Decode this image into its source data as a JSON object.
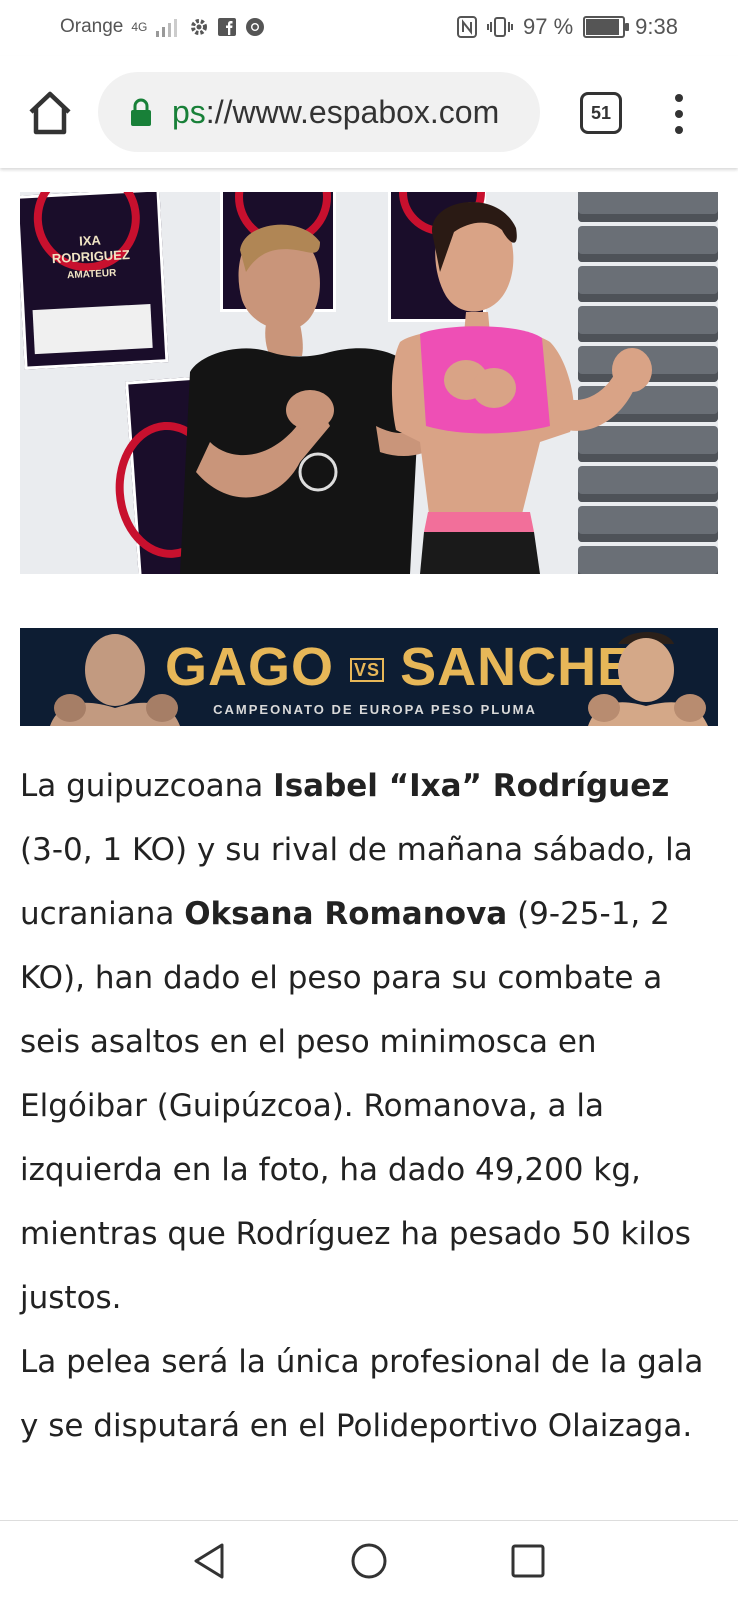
{
  "status_bar": {
    "carrier": "Orange",
    "network": "4G",
    "battery_percent": "97 %",
    "battery_level": 0.97,
    "time": "9:38"
  },
  "browser": {
    "url_scheme_fragment": "ps",
    "url_rest": "://www.espabox.com",
    "tab_count": "51",
    "icons": [
      "home-icon",
      "lock-icon",
      "tab-switcher-icon",
      "more-vert-icon"
    ]
  },
  "banner": {
    "fighter_left": "GAGO",
    "vs": "VS",
    "fighter_right": "SANCHEZ",
    "subtitle": "CAMPEONATO DE EUROPA PESO PLUMA",
    "colors": {
      "background": "#0d1d33",
      "title": "#e7b758"
    }
  },
  "photo": {
    "poster_text_1": "IXA",
    "poster_text_2": "RODRIGUEZ",
    "poster_text_3": "AMATEUR"
  },
  "article": {
    "p1_a": "La guipuzcoana ",
    "p1_name1": "Isabel “Ixa” Rodríguez",
    "p1_b": " (3-0, 1 KO) y su rival de mañana sábado, la ucraniana ",
    "p1_name2": "Oksana Romanova",
    "p1_c": " (9-25-1, 2 KO), han dado el peso para su combate a seis asaltos en el peso minimosca en Elgóibar (Guipúzcoa). Romanova, a la izquierda en la foto, ha dado 49,200 kg, mientras que Rodríguez ha pesado 50 kilos justos.",
    "p2": "La pelea será la única profesional de la gala y se disputará en el Polideportivo Olaizaga."
  },
  "nav_bar": {
    "icons": [
      "back-icon",
      "home-circle-icon",
      "recents-icon"
    ]
  }
}
